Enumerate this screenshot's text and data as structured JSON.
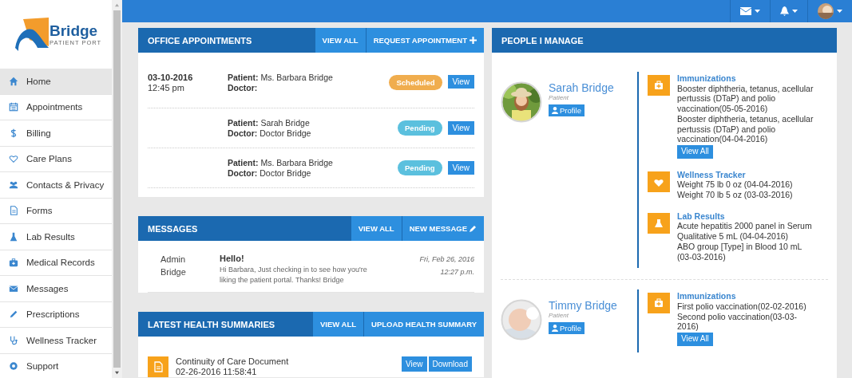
{
  "logo": {
    "name": "Bridge",
    "tagline": "PATIENT PORT"
  },
  "sidebar": {
    "items": [
      {
        "label": "Home",
        "selected": true
      },
      {
        "label": "Appointments",
        "selected": false
      },
      {
        "label": "Billing",
        "selected": false
      },
      {
        "label": "Care Plans",
        "selected": false
      },
      {
        "label": "Contacts & Privacy",
        "selected": false
      },
      {
        "label": "Forms",
        "selected": false
      },
      {
        "label": "Lab Results",
        "selected": false
      },
      {
        "label": "Medical Records",
        "selected": false
      },
      {
        "label": "Messages",
        "selected": false
      },
      {
        "label": "Prescriptions",
        "selected": false
      },
      {
        "label": "Wellness Tracker",
        "selected": false
      },
      {
        "label": "Support",
        "selected": false
      }
    ]
  },
  "appointments": {
    "title": "OFFICE APPOINTMENTS",
    "view_all": "VIEW ALL",
    "request": "REQUEST APPOINTMENT",
    "rows": [
      {
        "date": "03-10-2016",
        "time": "12:45 pm",
        "patient_label": "Patient:",
        "patient": "Ms. Barbara Bridge",
        "doctor_label": "Doctor:",
        "status": "Scheduled",
        "color": "#f0ad4e",
        "action": "View"
      },
      {
        "patient_label": "Patient:",
        "patient": "Sarah Bridge",
        "doctor_label": "Doctor:",
        "doctor": "Doctor Bridge",
        "status": "Pending",
        "color": "#5bc0de",
        "action": "View"
      },
      {
        "patient_label": "Patient:",
        "patient": "Ms. Barbara Bridge",
        "doctor_label": "Doctor:",
        "doctor": "Doctor Bridge",
        "status": "Pending",
        "color": "#5bc0de",
        "action": "View"
      }
    ]
  },
  "messages": {
    "title": "MESSAGES",
    "view_all": "VIEW ALL",
    "new_message": "NEW MESSAGE",
    "items": [
      {
        "sender": "Admin Bridge",
        "subject": "Hello!",
        "body": "Hi Barbara, Just checking in to see how you're liking the patient portal. Thanks! Bridge",
        "date": "Fri, Feb 26, 2016",
        "time": "12:27 p.m."
      }
    ]
  },
  "health_summaries": {
    "title": "LATEST HEALTH SUMMARIES",
    "view_all": "VIEW ALL",
    "upload": "UPLOAD HEALTH SUMMARY",
    "items": [
      {
        "title": "Continuity of Care Document",
        "date": "02-26-2016 11:58:41",
        "view": "View",
        "download": "Download"
      }
    ]
  },
  "people": {
    "title": "PEOPLE I MANAGE",
    "persons": [
      {
        "name": "Sarah Bridge",
        "role": "Patient",
        "profile": "Profile",
        "kind": "girl",
        "sections": [
          {
            "kind": "immunizations",
            "title": "Immunizations",
            "entries": [
              "Booster diphtheria, tetanus, acellular pertussis (DTaP) and polio vaccination(05-05-2016)",
              "Booster diphtheria, tetanus, acellular pertussis (DTaP) and polio vaccination(04-04-2016)"
            ],
            "view_all": "View All"
          },
          {
            "kind": "wellness",
            "title": "Wellness Tracker",
            "entries": [
              "Weight 75 lb 0 oz (04-04-2016)",
              "Weight 70 lb 5 oz (03-03-2016)"
            ]
          },
          {
            "kind": "lab",
            "title": "Lab Results",
            "entries": [
              "Acute hepatitis 2000 panel in Serum Qualitative 5 mL (04-04-2016)",
              "ABO group [Type] in Blood 10 mL (03-03-2016)"
            ]
          }
        ]
      },
      {
        "name": "Timmy Bridge",
        "role": "Patient",
        "profile": "Profile",
        "kind": "baby",
        "sections": [
          {
            "kind": "immunizations",
            "title": "Immunizations",
            "entries": [
              "First polio vaccination(02-02-2016)",
              "Second polio vaccination(03-03-2016)"
            ],
            "view_all": "View All"
          }
        ]
      }
    ]
  }
}
